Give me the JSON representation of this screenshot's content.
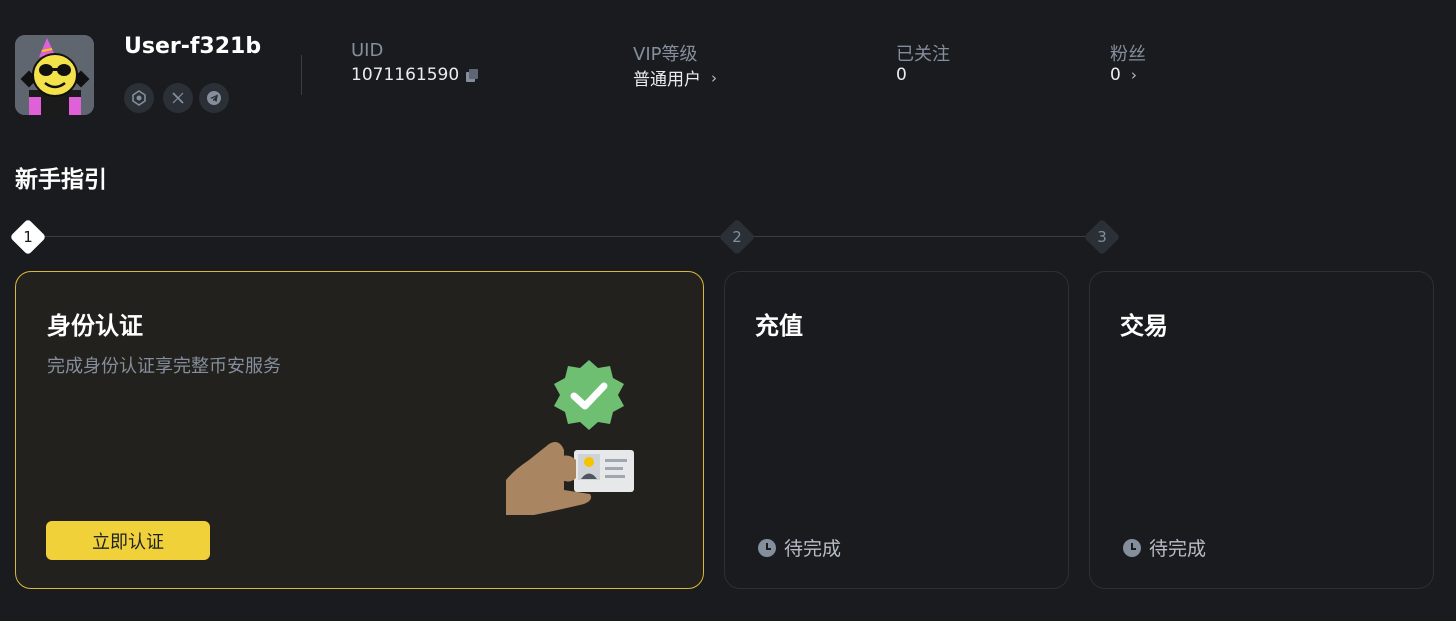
{
  "profile": {
    "username": "User-f321b",
    "social_icons": [
      "verified-badge-icon",
      "x-twitter-icon",
      "telegram-icon"
    ]
  },
  "stats": {
    "uid_label": "UID",
    "uid_value": "1071161590",
    "vip_label": "VIP等级",
    "vip_value": "普通用户",
    "following_label": "已关注",
    "following_value": "0",
    "followers_label": "粉丝",
    "followers_value": "0"
  },
  "guide": {
    "title": "新手指引",
    "steps": [
      {
        "number": "1",
        "title": "身份认证",
        "description": "完成身份认证享完整币安服务",
        "button_label": "立即认证",
        "active": true
      },
      {
        "number": "2",
        "title": "充值",
        "status": "待完成",
        "active": false
      },
      {
        "number": "3",
        "title": "交易",
        "status": "待完成",
        "active": false
      }
    ]
  },
  "colors": {
    "background": "#1a1b1f",
    "accent_yellow": "#f0d13a",
    "active_border": "#d8b93a",
    "muted_text": "#848e9c",
    "verify_green": "#6fbf73"
  }
}
